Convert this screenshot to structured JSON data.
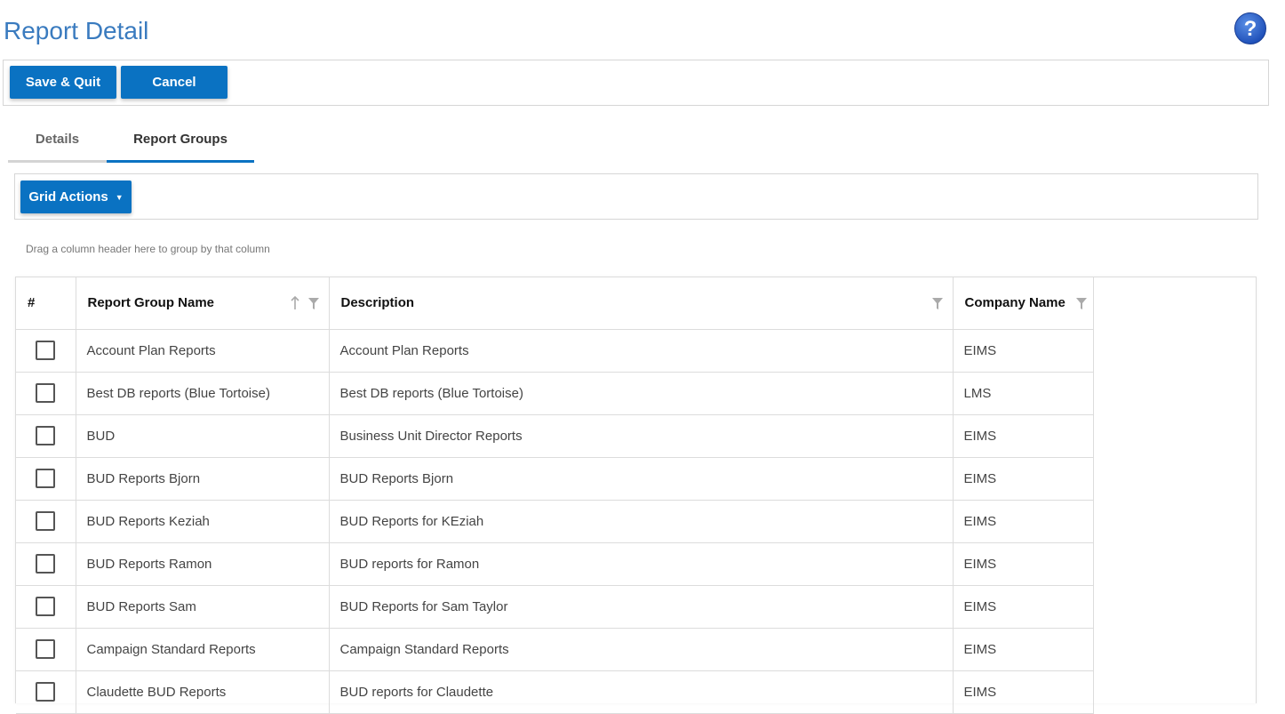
{
  "page": {
    "title": "Report Detail"
  },
  "toolbar": {
    "save_label": "Save & Quit",
    "cancel_label": "Cancel"
  },
  "tabs": [
    {
      "label": "Details",
      "active": false
    },
    {
      "label": "Report Groups",
      "active": true
    }
  ],
  "grid": {
    "actions_label": "Grid Actions",
    "group_hint": "Drag a column header here to group by that column",
    "columns": {
      "num": "#",
      "name": "Report Group Name",
      "description": "Description",
      "company": "Company Name"
    },
    "rows": [
      {
        "name": "Account Plan Reports",
        "description": "Account Plan Reports",
        "company": "EIMS"
      },
      {
        "name": "Best DB reports (Blue Tortoise)",
        "description": "Best DB reports (Blue Tortoise)",
        "company": "LMS"
      },
      {
        "name": "BUD",
        "description": "Business Unit Director Reports",
        "company": "EIMS"
      },
      {
        "name": "BUD Reports Bjorn",
        "description": "BUD Reports Bjorn",
        "company": "EIMS"
      },
      {
        "name": "BUD Reports Keziah",
        "description": "BUD Reports for KEziah",
        "company": "EIMS"
      },
      {
        "name": "BUD Reports Ramon",
        "description": "BUD reports for Ramon",
        "company": "EIMS"
      },
      {
        "name": "BUD Reports Sam",
        "description": "BUD Reports for Sam Taylor",
        "company": "EIMS"
      },
      {
        "name": "Campaign Standard Reports",
        "description": "Campaign Standard Reports",
        "company": "EIMS"
      },
      {
        "name": "Claudette BUD Reports",
        "description": "BUD reports for Claudette",
        "company": "EIMS"
      }
    ]
  },
  "colors": {
    "primary": "#0a72c2",
    "title": "#3a7bbf",
    "help_icon": "#2a62c9"
  },
  "icons": {
    "help": "question-circle-icon",
    "sort": "sort-ascending-icon",
    "filter": "filter-icon",
    "caret": "caret-down-icon"
  }
}
